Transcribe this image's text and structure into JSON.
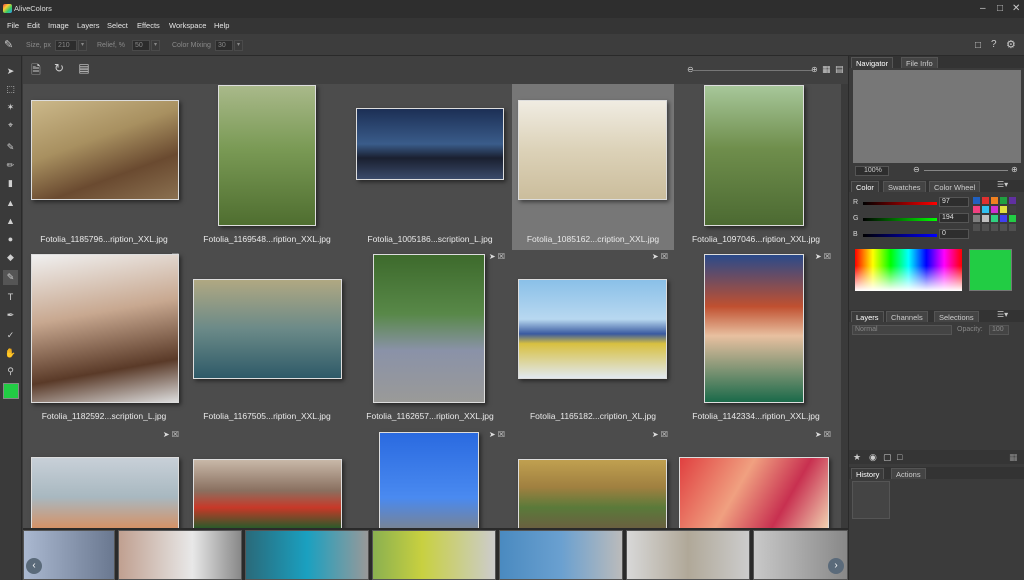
{
  "app": {
    "title": "AliveColors"
  },
  "menu": [
    "File",
    "Edit",
    "Image",
    "Layers",
    "Select",
    "Effects",
    "Workspace",
    "Help"
  ],
  "options": {
    "size_label": "Size, px",
    "size_value": "210",
    "relief_label": "Relief, %",
    "relief_value": "50",
    "mixing_label": "Color Mixing",
    "mixing_value": "30"
  },
  "files": [
    "Fotolia_1185796...ription_XXL.jpg",
    "Fotolia_1169548...ription_XXL.jpg",
    "Fotolia_1005186...scription_L.jpg",
    "Fotolia_1085162...cription_XXL.jpg",
    "Fotolia_1097046...ription_XXL.jpg",
    "Fotolia_1182592...scription_L.jpg",
    "Fotolia_1167505...ription_XXL.jpg",
    "Fotolia_1162657...ription_XXL.jpg",
    "Fotolia_1165182...cription_XL.jpg",
    "Fotolia_1142334...ription_XXL.jpg"
  ],
  "navigator": {
    "tab1": "Navigator",
    "tab2": "File Info",
    "zoom": "100%"
  },
  "color": {
    "tab1": "Color",
    "tab2": "Swatches",
    "tab3": "Color Wheel",
    "r_label": "R",
    "g_label": "G",
    "b_label": "B",
    "r": "97",
    "g": "194",
    "b": "0",
    "current_color": "#22cc44"
  },
  "layers": {
    "tab1": "Layers",
    "tab2": "Channels",
    "tab3": "Selections",
    "mode": "Normal",
    "opacity_label": "Opacity:",
    "opacity_value": "100"
  },
  "history": {
    "tab1": "History",
    "tab2": "Actions"
  }
}
